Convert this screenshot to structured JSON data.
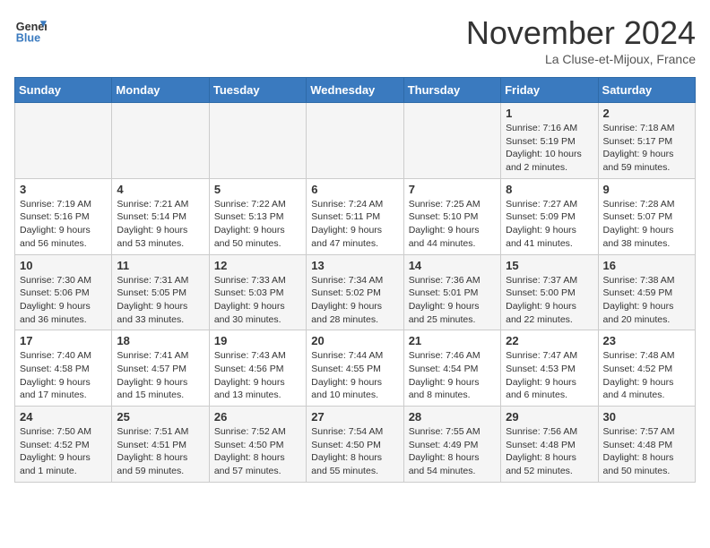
{
  "header": {
    "logo_line1": "General",
    "logo_line2": "Blue",
    "month_title": "November 2024",
    "location": "La Cluse-et-Mijoux, France"
  },
  "weekdays": [
    "Sunday",
    "Monday",
    "Tuesday",
    "Wednesday",
    "Thursday",
    "Friday",
    "Saturday"
  ],
  "weeks": [
    [
      {
        "day": "",
        "info": ""
      },
      {
        "day": "",
        "info": ""
      },
      {
        "day": "",
        "info": ""
      },
      {
        "day": "",
        "info": ""
      },
      {
        "day": "",
        "info": ""
      },
      {
        "day": "1",
        "info": "Sunrise: 7:16 AM\nSunset: 5:19 PM\nDaylight: 10 hours\nand 2 minutes."
      },
      {
        "day": "2",
        "info": "Sunrise: 7:18 AM\nSunset: 5:17 PM\nDaylight: 9 hours\nand 59 minutes."
      }
    ],
    [
      {
        "day": "3",
        "info": "Sunrise: 7:19 AM\nSunset: 5:16 PM\nDaylight: 9 hours\nand 56 minutes."
      },
      {
        "day": "4",
        "info": "Sunrise: 7:21 AM\nSunset: 5:14 PM\nDaylight: 9 hours\nand 53 minutes."
      },
      {
        "day": "5",
        "info": "Sunrise: 7:22 AM\nSunset: 5:13 PM\nDaylight: 9 hours\nand 50 minutes."
      },
      {
        "day": "6",
        "info": "Sunrise: 7:24 AM\nSunset: 5:11 PM\nDaylight: 9 hours\nand 47 minutes."
      },
      {
        "day": "7",
        "info": "Sunrise: 7:25 AM\nSunset: 5:10 PM\nDaylight: 9 hours\nand 44 minutes."
      },
      {
        "day": "8",
        "info": "Sunrise: 7:27 AM\nSunset: 5:09 PM\nDaylight: 9 hours\nand 41 minutes."
      },
      {
        "day": "9",
        "info": "Sunrise: 7:28 AM\nSunset: 5:07 PM\nDaylight: 9 hours\nand 38 minutes."
      }
    ],
    [
      {
        "day": "10",
        "info": "Sunrise: 7:30 AM\nSunset: 5:06 PM\nDaylight: 9 hours\nand 36 minutes."
      },
      {
        "day": "11",
        "info": "Sunrise: 7:31 AM\nSunset: 5:05 PM\nDaylight: 9 hours\nand 33 minutes."
      },
      {
        "day": "12",
        "info": "Sunrise: 7:33 AM\nSunset: 5:03 PM\nDaylight: 9 hours\nand 30 minutes."
      },
      {
        "day": "13",
        "info": "Sunrise: 7:34 AM\nSunset: 5:02 PM\nDaylight: 9 hours\nand 28 minutes."
      },
      {
        "day": "14",
        "info": "Sunrise: 7:36 AM\nSunset: 5:01 PM\nDaylight: 9 hours\nand 25 minutes."
      },
      {
        "day": "15",
        "info": "Sunrise: 7:37 AM\nSunset: 5:00 PM\nDaylight: 9 hours\nand 22 minutes."
      },
      {
        "day": "16",
        "info": "Sunrise: 7:38 AM\nSunset: 4:59 PM\nDaylight: 9 hours\nand 20 minutes."
      }
    ],
    [
      {
        "day": "17",
        "info": "Sunrise: 7:40 AM\nSunset: 4:58 PM\nDaylight: 9 hours\nand 17 minutes."
      },
      {
        "day": "18",
        "info": "Sunrise: 7:41 AM\nSunset: 4:57 PM\nDaylight: 9 hours\nand 15 minutes."
      },
      {
        "day": "19",
        "info": "Sunrise: 7:43 AM\nSunset: 4:56 PM\nDaylight: 9 hours\nand 13 minutes."
      },
      {
        "day": "20",
        "info": "Sunrise: 7:44 AM\nSunset: 4:55 PM\nDaylight: 9 hours\nand 10 minutes."
      },
      {
        "day": "21",
        "info": "Sunrise: 7:46 AM\nSunset: 4:54 PM\nDaylight: 9 hours\nand 8 minutes."
      },
      {
        "day": "22",
        "info": "Sunrise: 7:47 AM\nSunset: 4:53 PM\nDaylight: 9 hours\nand 6 minutes."
      },
      {
        "day": "23",
        "info": "Sunrise: 7:48 AM\nSunset: 4:52 PM\nDaylight: 9 hours\nand 4 minutes."
      }
    ],
    [
      {
        "day": "24",
        "info": "Sunrise: 7:50 AM\nSunset: 4:52 PM\nDaylight: 9 hours\nand 1 minute."
      },
      {
        "day": "25",
        "info": "Sunrise: 7:51 AM\nSunset: 4:51 PM\nDaylight: 8 hours\nand 59 minutes."
      },
      {
        "day": "26",
        "info": "Sunrise: 7:52 AM\nSunset: 4:50 PM\nDaylight: 8 hours\nand 57 minutes."
      },
      {
        "day": "27",
        "info": "Sunrise: 7:54 AM\nSunset: 4:50 PM\nDaylight: 8 hours\nand 55 minutes."
      },
      {
        "day": "28",
        "info": "Sunrise: 7:55 AM\nSunset: 4:49 PM\nDaylight: 8 hours\nand 54 minutes."
      },
      {
        "day": "29",
        "info": "Sunrise: 7:56 AM\nSunset: 4:48 PM\nDaylight: 8 hours\nand 52 minutes."
      },
      {
        "day": "30",
        "info": "Sunrise: 7:57 AM\nSunset: 4:48 PM\nDaylight: 8 hours\nand 50 minutes."
      }
    ]
  ]
}
